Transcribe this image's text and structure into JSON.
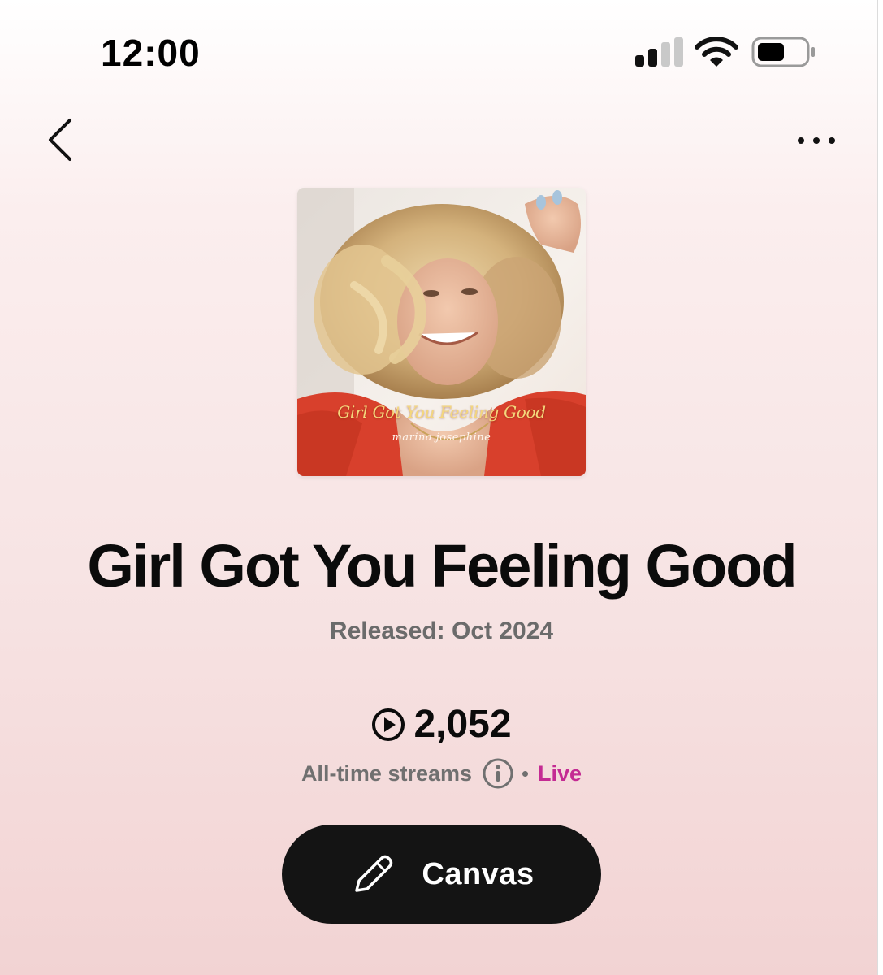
{
  "status_bar": {
    "time": "12:00",
    "icons": [
      "cellular-signal-icon",
      "wifi-icon",
      "battery-icon"
    ]
  },
  "nav": {
    "back_icon": "chevron-left-icon",
    "more_icon": "more-horizontal-icon"
  },
  "artwork": {
    "overlay_title": "Girl Got You Feeling Good",
    "overlay_artist": "marina josephine"
  },
  "song": {
    "title": "Girl Got You Feeling Good",
    "released": "Released: Oct 2024"
  },
  "streams": {
    "count": "2,052",
    "label": "All-time streams",
    "status": "Live",
    "icon": "play-circle-icon",
    "info_icon": "info-icon"
  },
  "canvas_button": {
    "label": "Canvas",
    "icon": "pencil-icon"
  },
  "colors": {
    "live_accent": "#c42b93",
    "button_bg": "#141414",
    "title_text": "#0b0b0b",
    "secondary_text": "#6b6b6b"
  }
}
